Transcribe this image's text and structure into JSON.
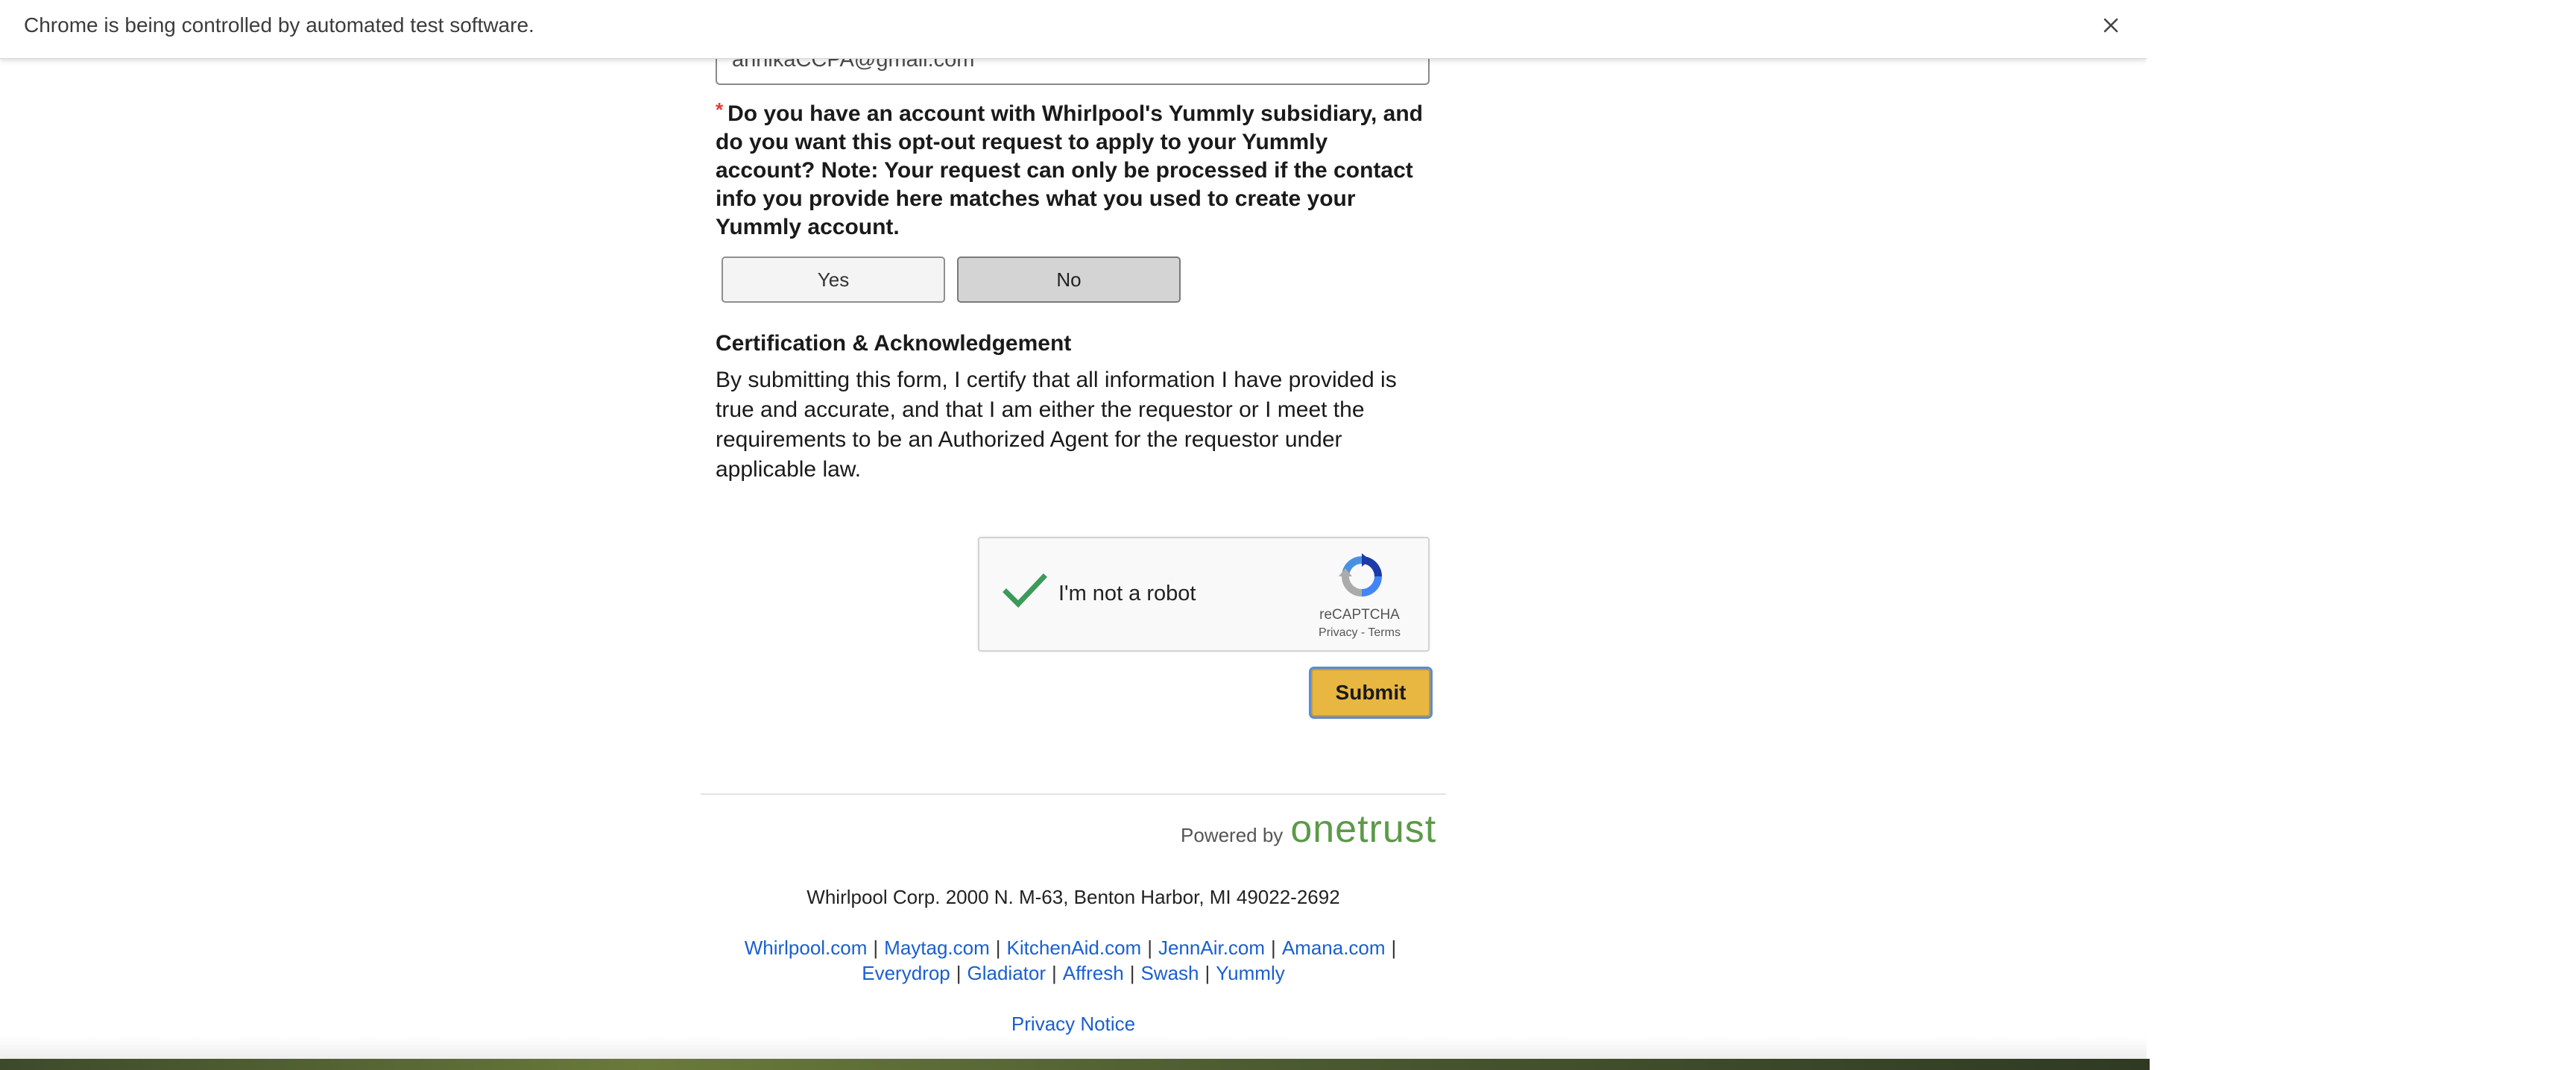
{
  "infobar": {
    "message": "Chrome is being controlled by automated test software.",
    "close_icon": "close-icon"
  },
  "form": {
    "email_value": "annikaCCPA@gmail.com",
    "required_marker": "*",
    "yummly_question": "Do you have an account with Whirlpool's Yummly subsidiary, and do you want this opt-out request to apply to your Yummly account? Note: Your request can only be processed if the contact info you provide here matches what you used to create your Yummly account.",
    "yes_label": "Yes",
    "no_label": "No",
    "selected_option": "No",
    "cert_heading": "Certification & Acknowledgement",
    "cert_body": "By submitting this form, I certify that all information I have provided is true and accurate, and that I am either the requestor or I meet the requirements to be an Authorized Agent for the requestor under applicable law.",
    "submit_label": "Submit"
  },
  "recaptcha": {
    "label": "I'm not a robot",
    "brand": "reCAPTCHA",
    "privacy_link": "Privacy",
    "separator": "-",
    "terms_link": "Terms",
    "checked": true
  },
  "footer": {
    "powered_by_label": "Powered by",
    "powered_by_brand": "onetrust",
    "address": "Whirlpool Corp. 2000 N. M-63, Benton Harbor, MI 49022-2692",
    "links_row1": [
      "Whirlpool.com",
      "Maytag.com",
      "KitchenAid.com",
      "JennAir.com",
      "Amana.com"
    ],
    "links_row2": [
      "Everydrop",
      "Gladiator",
      "Affresh",
      "Swash",
      "Yummly"
    ],
    "separator": "|",
    "privacy_notice": "Privacy Notice"
  },
  "colors": {
    "submit_bg": "#e8b741",
    "submit_border": "#5b8bd6",
    "link": "#1a5fd0",
    "onetrust_green": "#5c9a48",
    "required": "#e03a3a",
    "check_green": "#3c9a5a"
  }
}
